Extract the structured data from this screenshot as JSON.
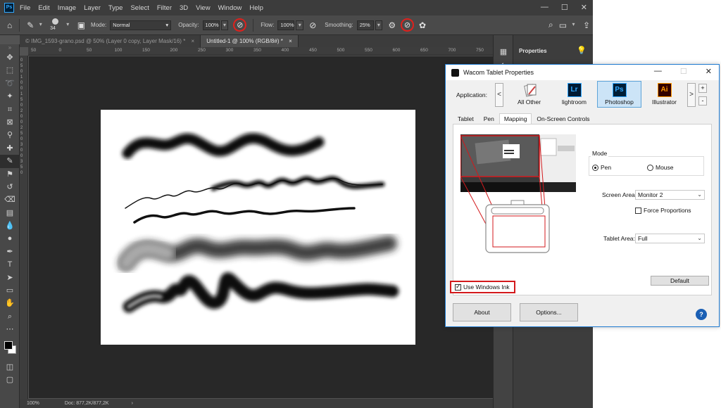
{
  "photoshop": {
    "logo": "Ps",
    "menu": [
      "File",
      "Edit",
      "Image",
      "Layer",
      "Type",
      "Select",
      "Filter",
      "3D",
      "View",
      "Window",
      "Help"
    ],
    "window_controls": [
      "—",
      "☐",
      "✕"
    ],
    "options": {
      "brush_size": "34",
      "mode_label": "Mode:",
      "mode_value": "Normal",
      "opacity_label": "Opacity:",
      "opacity_value": "100%",
      "flow_label": "Flow:",
      "flow_value": "100%",
      "smoothing_label": "Smoothing:",
      "smoothing_value": "25%"
    },
    "tabs": [
      {
        "label": "© IMG_1593-grano.psd @ 50% (Layer 0 copy, Layer Mask/16) *",
        "close": "×"
      },
      {
        "label": "Untitled-1 @ 100% (RGB/8#) *",
        "close": "×"
      }
    ],
    "ruler_top": [
      "50",
      "0",
      "50",
      "100",
      "150",
      "200",
      "250",
      "300",
      "350",
      "400",
      "450",
      "500",
      "550",
      "600",
      "650",
      "700",
      "750"
    ],
    "ruler_left": [
      "0",
      "5",
      "0",
      "1",
      "0",
      "0",
      "1",
      "5",
      "0",
      "2",
      "0",
      "0",
      "2",
      "5",
      "0",
      "3",
      "0",
      "0",
      "3",
      "5",
      "0"
    ],
    "status": {
      "zoom": "100%",
      "doc": "Doc: 877,2K/877,2K",
      "arrow": "›"
    },
    "right_panel": {
      "properties": "Properties"
    }
  },
  "wacom": {
    "title": "Wacom Tablet Properties",
    "controls": {
      "minimize": "—",
      "maximize": "☐",
      "close": "✕"
    },
    "application_label": "Application:",
    "prev": "<",
    "next": ">",
    "add": "+",
    "remove": "-",
    "apps": [
      {
        "name": "All Other",
        "icon": "all-other-icon",
        "glyph": "",
        "selected": false
      },
      {
        "name": "lightroom",
        "icon": "lightroom-icon",
        "glyph": "Lr",
        "selected": false
      },
      {
        "name": "Photoshop",
        "icon": "photoshop-icon",
        "glyph": "Ps",
        "selected": true
      },
      {
        "name": "Illustrator",
        "icon": "illustrator-icon",
        "glyph": "Ai",
        "selected": false
      }
    ],
    "tabs": [
      "Tablet",
      "Pen",
      "Mapping",
      "On-Screen Controls"
    ],
    "active_tab": "Mapping",
    "mode_label": "Mode",
    "pen_option": "Pen",
    "mouse_option": "Mouse",
    "screen_area_label": "Screen Area:",
    "screen_area_value": "Monitor 2",
    "force_proportions": "Force Proportions",
    "tablet_area_label": "Tablet Area:",
    "tablet_area_value": "Full",
    "use_windows_ink": "Use Windows Ink",
    "default_button": "Default",
    "about_button": "About",
    "options_button": "Options...",
    "help": "?"
  }
}
